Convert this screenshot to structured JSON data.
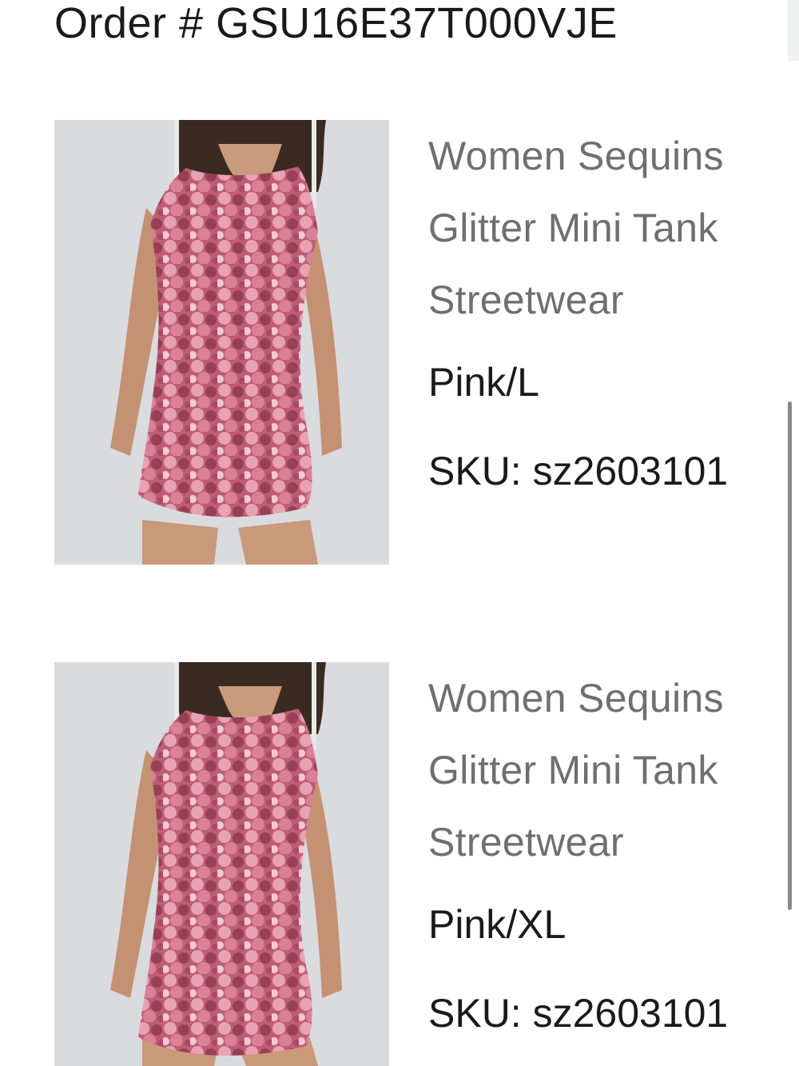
{
  "order": {
    "label": "Order # GSU16E37T000VJE"
  },
  "items": [
    {
      "title_lines": [
        "Women Sequins",
        "Glitter Mini Tank",
        "Streetwear"
      ],
      "variant": "Pink/L",
      "sku": "SKU: sz2603101"
    },
    {
      "title_lines": [
        "Women Sequins",
        "Glitter Mini Tank",
        "Streetwear"
      ],
      "variant": "Pink/XL",
      "sku": "SKU: sz2603101"
    }
  ],
  "icons": {
    "product_image": "product-photo-sequin-dress"
  },
  "colors": {
    "dress_pink": "#c9677f",
    "title_gray": "#6f6f6f",
    "text_dark": "#1a1a1a"
  }
}
